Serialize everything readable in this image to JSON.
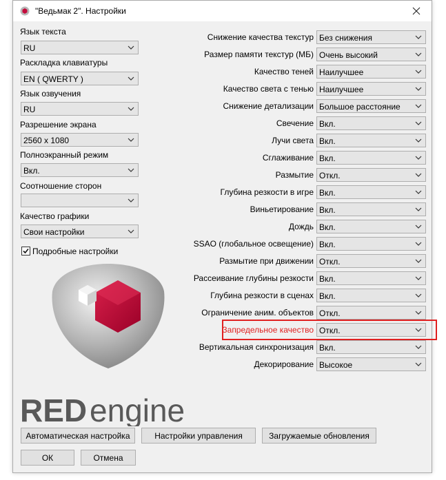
{
  "window": {
    "title": "\"Ведьмак 2\". Настройки"
  },
  "left": {
    "text_language": {
      "label": "Язык текста",
      "value": "RU"
    },
    "keyboard_layout": {
      "label": "Раскладка клавиатуры",
      "value": "EN ( QWERTY )"
    },
    "voice_language": {
      "label": "Язык озвучения",
      "value": "RU"
    },
    "resolution": {
      "label": "Разрешение экрана",
      "value": "2560 x 1080"
    },
    "fullscreen": {
      "label": "Полноэкранный режим",
      "value": "Вкл."
    },
    "aspect_ratio": {
      "label": "Соотношение сторон",
      "value": ""
    },
    "graphics_quality": {
      "label": "Качество графики",
      "value": "Свои настройки"
    },
    "detailed_settings": {
      "label": "Подробные настройки",
      "checked": true
    }
  },
  "right": [
    {
      "label": "Снижение качества текстур",
      "value": "Без снижения"
    },
    {
      "label": "Размер памяти текстур (МБ)",
      "value": "Очень высокий"
    },
    {
      "label": "Качество теней",
      "value": "Наилучшее"
    },
    {
      "label": "Качество света с тенью",
      "value": "Наилучшее"
    },
    {
      "label": "Снижение детализации",
      "value": "Большое расстояние"
    },
    {
      "label": "Свечение",
      "value": "Вкл."
    },
    {
      "label": "Лучи света",
      "value": "Вкл."
    },
    {
      "label": "Сглаживание",
      "value": "Вкл."
    },
    {
      "label": "Размытие",
      "value": "Откл."
    },
    {
      "label": "Глубина резкости в игре",
      "value": "Вкл."
    },
    {
      "label": "Виньетирование",
      "value": "Вкл."
    },
    {
      "label": "Дождь",
      "value": "Вкл."
    },
    {
      "label": "SSAO (глобальное освещение)",
      "value": "Вкл."
    },
    {
      "label": "Размытие при движении",
      "value": "Откл."
    },
    {
      "label": "Рассеивание глубины резкости",
      "value": "Вкл."
    },
    {
      "label": "Глубина резкости в сценах",
      "value": "Вкл."
    },
    {
      "label": "Ограничение аним. объектов",
      "value": "Откл."
    },
    {
      "label": "Запредельное качество",
      "value": "Откл."
    },
    {
      "label": "Вертикальная синхронизация",
      "value": "Вкл."
    },
    {
      "label": "Декорирование",
      "value": "Высокое"
    }
  ],
  "logo": {
    "text_red": "RED",
    "text_engine": "engine"
  },
  "buttons": {
    "auto_config": "Автоматическая настройка",
    "controls": "Настройки управления",
    "dlc": "Загружаемые обновления",
    "ok": "ОК",
    "cancel": "Отмена"
  },
  "colors": {
    "highlight": "#e02020",
    "hex_red": "#c40c3c",
    "logo_gray": "#595959"
  }
}
